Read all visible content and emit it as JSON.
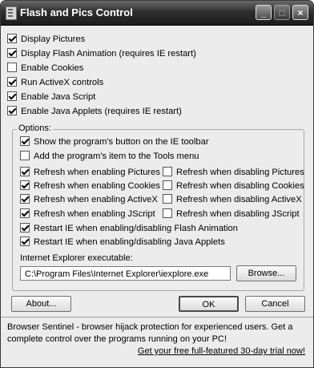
{
  "window": {
    "title": "Flash and Pics Control",
    "minimize_label": "_",
    "maximize_label": "□",
    "close_label": "×"
  },
  "top_options": [
    {
      "label": "Display Pictures",
      "checked": true
    },
    {
      "label": "Display Flash Animation (requires IE restart)",
      "checked": true
    },
    {
      "label": "Enable Cookies",
      "checked": false
    },
    {
      "label": "Run ActiveX controls",
      "checked": true
    },
    {
      "label": "Enable Java Script",
      "checked": true
    },
    {
      "label": "Enable Java Applets (requires IE restart)",
      "checked": true
    }
  ],
  "options_group": {
    "label": "Options:",
    "show_button": {
      "label": "Show the program's button on the IE toolbar",
      "checked": true
    },
    "tools_menu": {
      "label": "Add the program's item to the Tools menu",
      "checked": false
    },
    "refresh_enable": [
      {
        "label": "Refresh when enabling Pictures",
        "checked": true
      },
      {
        "label": "Refresh when enabling Cookies",
        "checked": true
      },
      {
        "label": "Refresh when enabling ActiveX",
        "checked": true
      },
      {
        "label": "Refresh when enabling JScript",
        "checked": true
      }
    ],
    "refresh_disable": [
      {
        "label": "Refresh when disabling Pictures",
        "checked": false
      },
      {
        "label": "Refresh when disabling Cookies",
        "checked": false
      },
      {
        "label": "Refresh when disabling ActiveX",
        "checked": false
      },
      {
        "label": "Refresh when disabling JScript",
        "checked": false
      }
    ],
    "restart_flash": {
      "label": "Restart IE when enabling/disabling Flash Animation",
      "checked": true
    },
    "restart_java": {
      "label": "Restart IE when enabling/disabling Java Applets",
      "checked": true
    },
    "ie_exe_label": "Internet Explorer executable:",
    "ie_exe_value": "C:\\Program Files\\Internet Explorer\\iexplore.exe",
    "browse_label": "Browse..."
  },
  "buttons": {
    "about": "About...",
    "ok": "OK",
    "cancel": "Cancel"
  },
  "footer": {
    "text": "Browser Sentinel - browser hijack protection for experienced users. Get a complete control over the programs running on your PC!",
    "link": "Get your free full-featured 30-day trial now!"
  }
}
